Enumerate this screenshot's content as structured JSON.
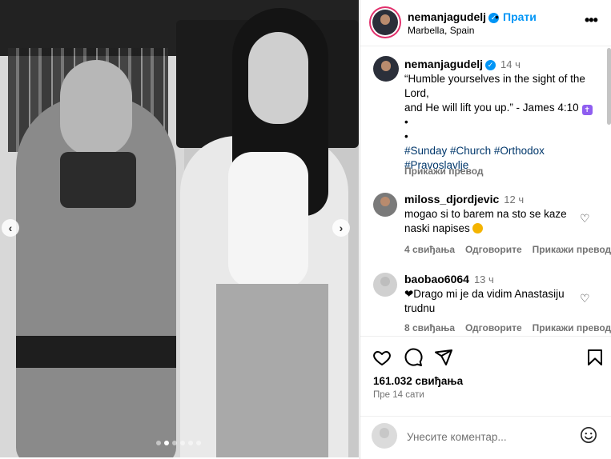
{
  "header": {
    "username": "nemanjagudelj",
    "verified_icon": "verified-badge-icon",
    "separator": "•",
    "follow_label": "Прати",
    "location": "Marbella, Spain",
    "more": "•••"
  },
  "carousel": {
    "prev": "‹",
    "next": "›",
    "total_slides": 6,
    "active_slide": 2
  },
  "caption": {
    "username": "nemanjagudelj",
    "time": "14 ч",
    "lines": [
      "“Humble yourselves in the sight of the",
      "Lord,",
      "and He will lift you up.” - James 4:10"
    ],
    "bullet1": "•",
    "bullet2": "•",
    "hashtags_line1": "#Sunday #Church #Orthodox",
    "hashtags_line2": "#Pravoslavlje",
    "translate": "Прикажи превод"
  },
  "comments": [
    {
      "username": "miloss_djordjevic",
      "time": "12 ч",
      "text_line1": "mogao si to barem na sto se kaze",
      "text_line2": "naski napises",
      "likes": "4 свиђања",
      "reply": "Одговорите",
      "translate": "Прикажи превод"
    },
    {
      "username": "baobao6064",
      "time": "13 ч",
      "text_line1": "❤Drago mi je da vidim Anastasiju",
      "text_line2": "trudnu",
      "likes": "8 свиђања",
      "reply": "Одговорите",
      "translate": "Прикажи превод"
    }
  ],
  "actions": {
    "likes": "161.032 свиђања",
    "ago": "Пре 14 сати"
  },
  "add_comment": {
    "placeholder": "Унесите коментар..."
  },
  "colors": {
    "accent": "#0095f6",
    "secondary_text": "#737373",
    "hashtag": "#00376b"
  }
}
